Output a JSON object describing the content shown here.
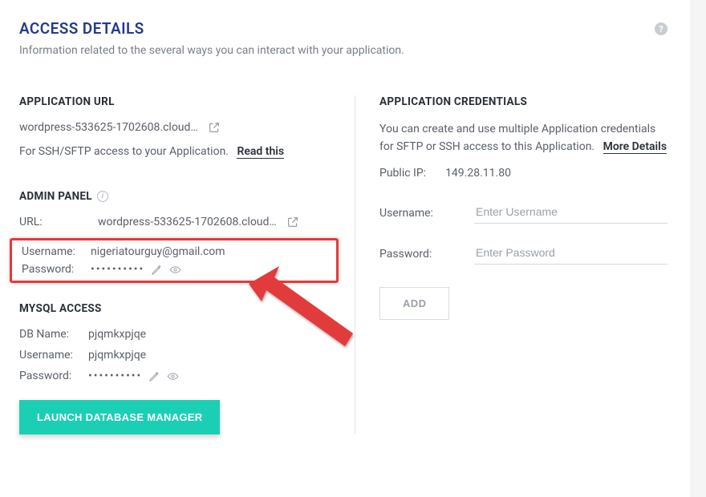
{
  "header": {
    "title": "ACCESS DETAILS",
    "subtitle": "Information related to the several ways you can interact with your application."
  },
  "app_url": {
    "heading": "APPLICATION URL",
    "url": "wordpress-533625-1702608.cloud…",
    "sftp_prefix": "For SSH/SFTP access to your Application.",
    "read_this": "Read this"
  },
  "admin": {
    "heading": "ADMIN PANEL",
    "url_label": "URL:",
    "url_value": "wordpress-533625-1702608.cloud…",
    "username_label": "Username:",
    "username_value": "nigeriatourguy@gmail.com",
    "password_label": "Password:",
    "password_mask": "••••••••••"
  },
  "mysql": {
    "heading": "MYSQL ACCESS",
    "dbname_label": "DB Name:",
    "dbname_value": "pjqmkxpjqe",
    "username_label": "Username:",
    "username_value": "pjqmkxpjqe",
    "password_label": "Password:",
    "password_mask": "••••••••••",
    "launch_btn": "LAUNCH DATABASE MANAGER"
  },
  "creds": {
    "heading": "APPLICATION CREDENTIALS",
    "desc": "You can create and use multiple Application credentials for SFTP or SSH access to this Application.",
    "more": "More Details",
    "ip_label": "Public IP:",
    "ip_value": "149.28.11.80",
    "username_label": "Username:",
    "username_placeholder": "Enter Username",
    "password_label": "Password:",
    "password_placeholder": "Enter Password",
    "add_btn": "ADD"
  }
}
